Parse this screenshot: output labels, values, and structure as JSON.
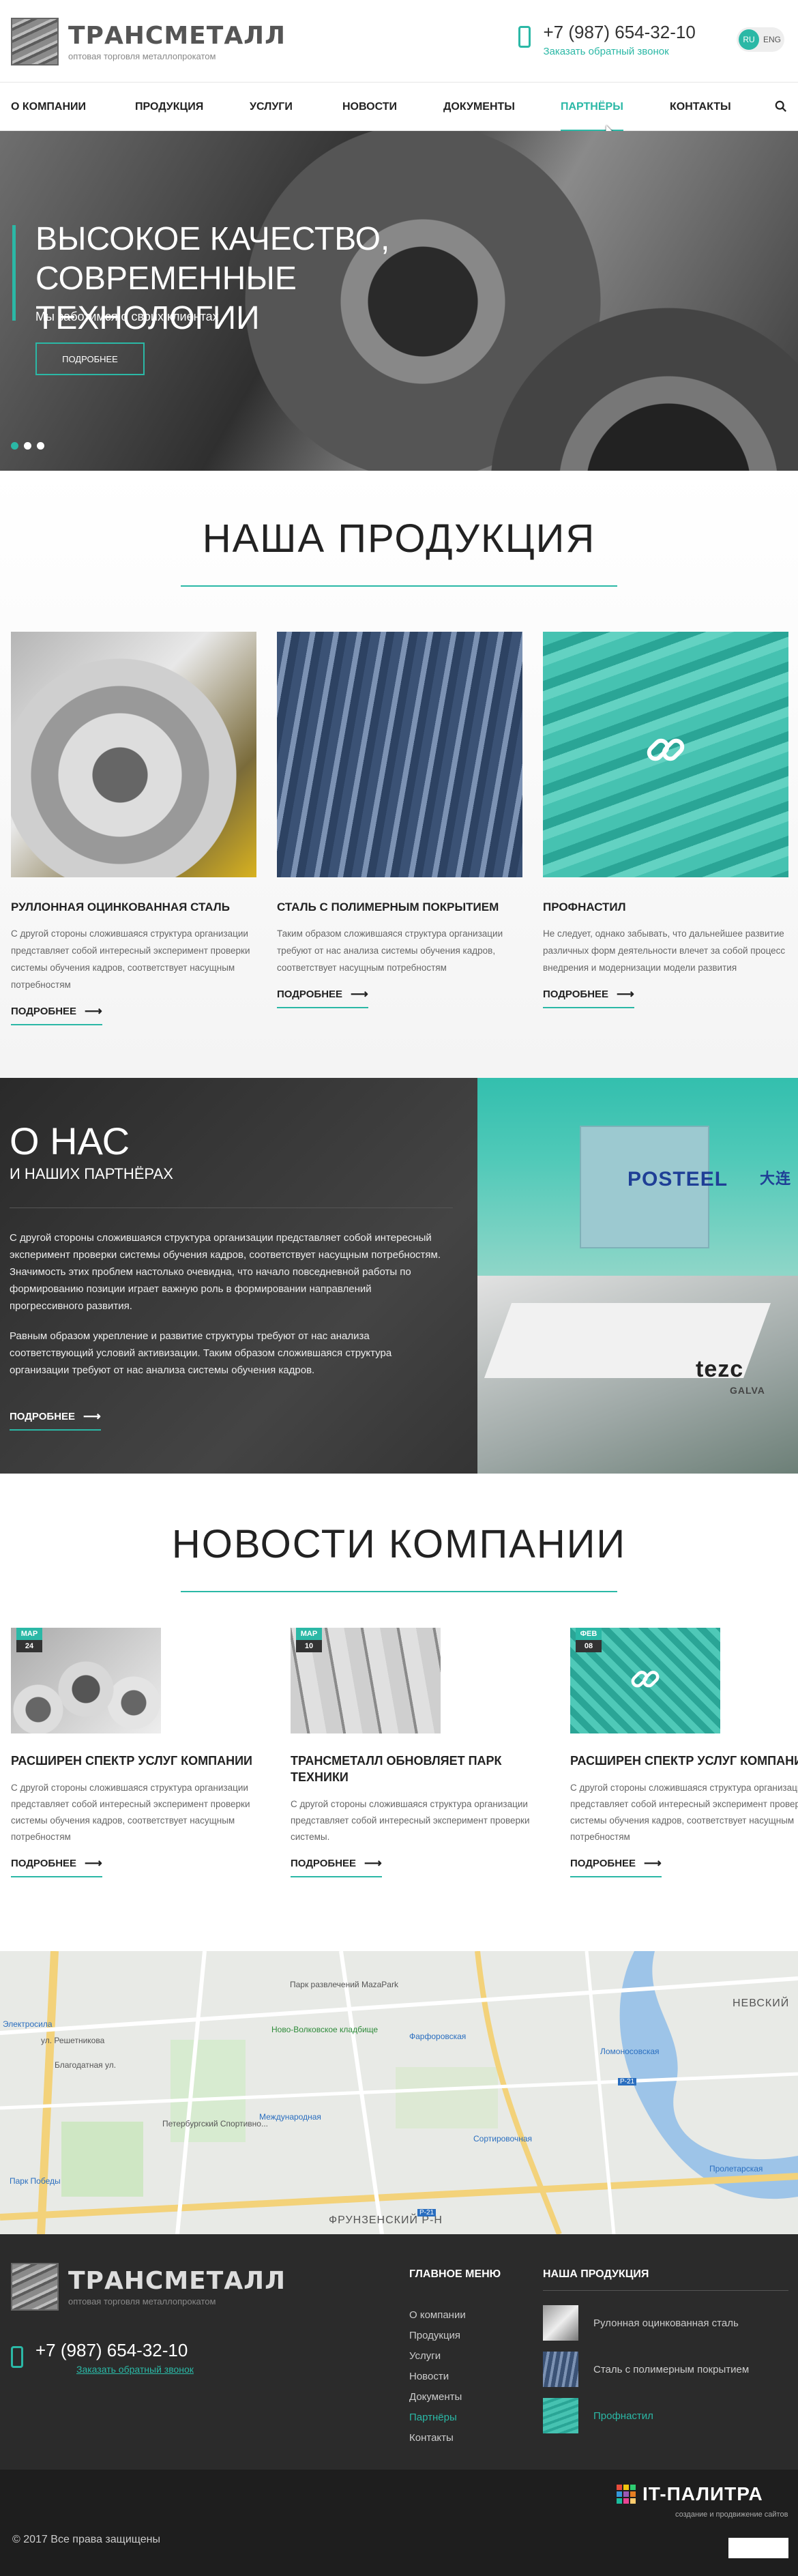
{
  "header": {
    "logo_name": "ТРАНСМЕТАЛЛ",
    "logo_sub": "оптовая торговля металлопрокатом",
    "phone": "+7 (987) 654-32-10",
    "callback": "Заказать обратный звонок",
    "lang_ru": "RU",
    "lang_en": "ENG"
  },
  "nav": {
    "items": [
      {
        "label": "О КОМПАНИИ"
      },
      {
        "label": "ПРОДУКЦИЯ"
      },
      {
        "label": "УСЛУГИ"
      },
      {
        "label": "НОВОСТИ"
      },
      {
        "label": "ДОКУМЕНТЫ"
      },
      {
        "label": "ПАРТНЁРЫ"
      },
      {
        "label": "КОНТАКТЫ"
      }
    ],
    "active_index": 5
  },
  "hero": {
    "title": "ВЫСОКОЕ КАЧЕСТВО, СОВРЕМЕННЫЕ ТЕХНОЛОГИИ",
    "subtitle": "Мы заботимся о своих клиентах",
    "button": "ПОДРОБНЕЕ",
    "slides": 3,
    "active_slide": 1
  },
  "products": {
    "title": "НАША ПРОДУКЦИЯ",
    "items": [
      {
        "title": "РУЛЛОННАЯ ОЦИНКОВАННАЯ СТАЛЬ",
        "text": "С другой стороны сложившаяся структура организации представляет собой интересный эксперимент проверки системы обучения кадров, соответствует насущным потребностям",
        "more": "ПОДРОБНЕЕ"
      },
      {
        "title": "СТАЛЬ С ПОЛИМЕРНЫМ ПОКРЫТИЕМ",
        "text": "Таким образом сложившаяся структура организации требуют от нас анализа системы обучения кадров, соответствует насущным потребностям",
        "more": "ПОДРОБНЕЕ"
      },
      {
        "title": "ПРОФНАСТИЛ",
        "text": "Не следует, однако забывать, что дальнейшее развитие различных форм деятельности влечет за собой процесс внедрения и модернизации модели развития",
        "more": "ПОДРОБНЕЕ"
      }
    ]
  },
  "about": {
    "title": "О НАС",
    "subtitle": "И НАШИХ ПАРТНЁРАХ",
    "p1": "С другой стороны сложившаяся структура организации представляет собой интересный эксперимент проверки системы обучения кадров, соответствует насущным потребностям. Значимость этих проблем настолько очевидна, что начало повседневной работы по формированию позиции играет важную роль в формировании направлений прогрессивного развития.",
    "p2": "Равным образом укрепление и развитие структуры требуют от нас анализа соответствующий условий активизации. Таким образом сложившаяся структура организации требуют от нас анализа системы обучения кадров.",
    "more": "ПОДРОБНЕЕ",
    "partner1": "POSTEEL",
    "partner1_cn": "大连",
    "partner2": "tezc",
    "partner2_sub": "GALVA"
  },
  "news": {
    "title": "НОВОСТИ КОМПАНИИ",
    "items": [
      {
        "month": "МАР",
        "day": "24",
        "title": "РАСШИРЕН СПЕКТР УСЛУГ КОМПАНИИ",
        "text": "С другой стороны сложившаяся структура организации представляет собой интересный эксперимент проверки системы обучения кадров, соответствует насущным потребностям",
        "more": "ПОДРОБНЕЕ"
      },
      {
        "month": "МАР",
        "day": "10",
        "title": "ТРАНСМЕТАЛЛ ОБНОВЛЯЕТ ПАРК ТЕХНИКИ",
        "text": "С другой стороны сложившаяся структура организации представляет собой интересный эксперимент проверки системы.",
        "more": "ПОДРОБНЕЕ"
      },
      {
        "month": "ФЕВ",
        "day": "08",
        "title": "РАСШИРЕН СПЕКТР УСЛУГ КОМПАНИИ",
        "text": "С другой стороны сложившаяся структура организации представляет собой интересный эксперимент проверки системы обучения кадров, соответствует насущным потребностям",
        "more": "ПОДРОБНЕЕ"
      }
    ]
  },
  "map": {
    "labels": [
      "Парк развлечений MazaPark",
      "Ново-Волковское кладбище",
      "Фарфоровская",
      "НЕВСКИЙ",
      "Ломоносовская",
      "Петербургский Спортивно...",
      "Международная",
      "Сортировочная",
      "ФРУНЗЕНСКИЙ Р-Н",
      "Пролетарская",
      "Парк Победы",
      "Благодатная ул.",
      "ул. Решетникова",
      "Электросила",
      "P-21",
      "P-21"
    ]
  },
  "footer": {
    "logo_name": "ТРАНСМЕТАЛЛ",
    "logo_sub": "оптовая торговля металлопрокатом",
    "phone": "+7 (987) 654-32-10",
    "callback": "Заказать обратный звонок",
    "menu_title": "ГЛАВНОЕ МЕНЮ",
    "menu": [
      "О компании",
      "Продукция",
      "Услуги",
      "Новости",
      "Документы",
      "Партнёры",
      "Контакты"
    ],
    "menu_active_index": 5,
    "products_title": "НАША ПРОДУКЦИЯ",
    "products": [
      "Рулонная оцинкованная сталь",
      "Сталь с полимерным покрытием",
      "Профнастил"
    ],
    "copyright": "© 2017 Все права защищены",
    "dev_name": "IT-ПАЛИТРА",
    "dev_sub": "создание и продвижение сайтов"
  },
  "colors": {
    "accent": "#2bb8a6",
    "dark": "#2b2b2b"
  }
}
